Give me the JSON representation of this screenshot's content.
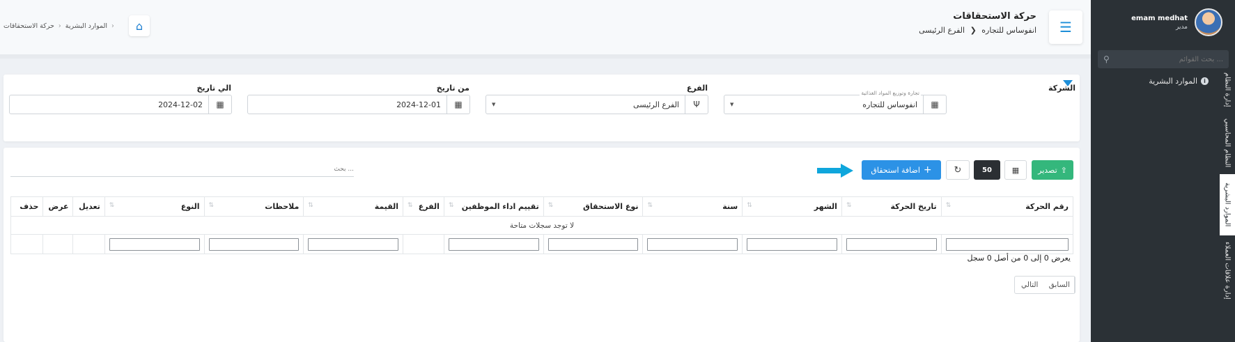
{
  "user": {
    "name": "emam medhat",
    "role": "مدير"
  },
  "sidebar": {
    "search_placeholder": "بحث القوائم ...",
    "active_menu": "الموارد البشرية",
    "vertical_tabs": [
      "إدارة النظام",
      "النظام المحاسبي",
      "الموارد البشرية",
      "إدارة علاقات العملاء"
    ]
  },
  "header": {
    "title": "حركة الاستحقاقات",
    "company": "انفوساس للتجاره",
    "branch": "الفرع الرئيسى",
    "breadcrumb": [
      "الموارد البشرية",
      "حركة الاستحقاقات"
    ]
  },
  "filters": {
    "company_label": "الشركة",
    "company_hint": "تجارة وتوزيع المواد الغذائية",
    "company_value": "انفوساس للتجاره",
    "branch_label": "الفرع",
    "branch_value": "الفرع الرئيسى",
    "from_label": "من تاريخ",
    "from_value": "2024-12-01",
    "to_label": "الي تاريخ",
    "to_value": "2024-12-02"
  },
  "toolbar": {
    "export_label": "تصدير",
    "page_size": "50",
    "add_label": "اضافة استحقاق",
    "search_placeholder": "بحث ..."
  },
  "table": {
    "columns": [
      "رقم الحركة",
      "تاريخ الحركة",
      "الشهر",
      "سنة",
      "نوع الاستحقاق",
      "تقييم اداء الموظفين",
      "الفرع",
      "القيمة",
      "ملاحظات",
      "النوع",
      "تعديل",
      "عرض",
      "حذف"
    ],
    "empty_message": "لا توجد سجلات متاحة"
  },
  "footer": {
    "info": "يعرض 0 إلى 0 من أصل 0 سجل",
    "prev_label": "السابق",
    "next_label": "التالي"
  },
  "colors": {
    "primary": "#2c92e6",
    "success": "#34b77c",
    "sidebar": "#2b3136",
    "arrow": "#0fa6dc"
  }
}
